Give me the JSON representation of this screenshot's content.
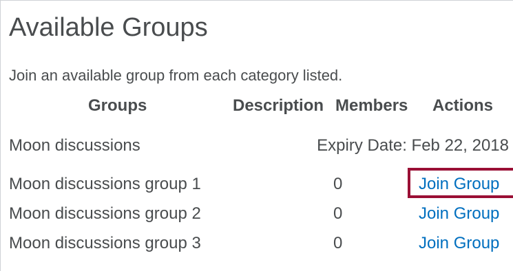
{
  "page": {
    "title": "Available Groups",
    "intro": "Join an available group from each category listed."
  },
  "table": {
    "headers": {
      "groups": "Groups",
      "description": "Description",
      "members": "Members",
      "actions": "Actions"
    },
    "category": {
      "name": "Moon discussions",
      "expiry": "Expiry Date: Feb 22, 2018"
    },
    "rows": [
      {
        "name": "Moon discussions group 1",
        "members": "0",
        "action": "Join Group",
        "highlighted": true
      },
      {
        "name": "Moon discussions group 2",
        "members": "0",
        "action": "Join Group"
      },
      {
        "name": "Moon discussions group 3",
        "members": "0",
        "action": "Join Group"
      }
    ]
  },
  "colors": {
    "text": "#494c4e",
    "link": "#006fbf",
    "highlight_border": "#9a0f35",
    "frame_border": "#cfd2d6"
  }
}
